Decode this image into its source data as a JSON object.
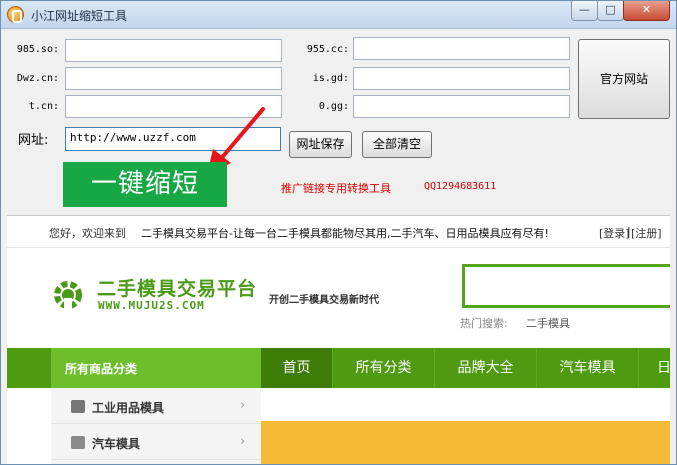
{
  "window": {
    "title": "小江网址缩短工具",
    "min_glyph": "—",
    "max_glyph": "□",
    "close_glyph": "✕",
    "icon": "app-logo-icon"
  },
  "form": {
    "fields": [
      {
        "name": "985-so",
        "label": "985.so:",
        "value": ""
      },
      {
        "name": "dwz-cn",
        "label": "Dwz.cn:",
        "value": ""
      },
      {
        "name": "t-cn",
        "label": "t.cn:",
        "value": ""
      },
      {
        "name": "955-cc",
        "label": "955.cc:",
        "value": ""
      },
      {
        "name": "is-gd",
        "label": "is.gd:",
        "value": ""
      },
      {
        "name": "0-gg",
        "label": "0.gg:",
        "value": ""
      }
    ],
    "url_label": "网址:",
    "url_value": "http://www.uzzf.com",
    "official_site_button": "官方网站",
    "save_url_button": "网址保存",
    "clear_all_button": "全部清空",
    "one_click_button": "一键缩短",
    "promo_text": "推广链接专用转换工具",
    "qq_text": "QQ1294683611",
    "annotation_arrow_color": "#e8141c"
  },
  "website": {
    "welcome_text": "您好，欢迎来到",
    "site_slogan_link": "二手模具交易平台-让每一台二手模具都能物尽其用,二手汽车、日用品模具应有尽有!",
    "login": "[登录]",
    "separator": "|",
    "register": "[注册]",
    "logo_cn": "二手模具交易平台",
    "logo_en": "WWW.MUJU2S.COM",
    "tagline": "开创二手模具交易新时代",
    "search_placeholder": "",
    "hot_search_label": "热门搜索:",
    "hot_search_item": "二手模具",
    "category_header": "所有商品分类",
    "nav_items": [
      "首页",
      "所有分类",
      "品牌大全",
      "汽车模具",
      "日"
    ],
    "categories": [
      {
        "label": "工业用品模具",
        "icon": "tools-icon"
      },
      {
        "label": "汽车模具",
        "icon": "car-icon"
      }
    ],
    "brand_color": "#4e9a10",
    "accent_green": "#6cbf2a"
  }
}
